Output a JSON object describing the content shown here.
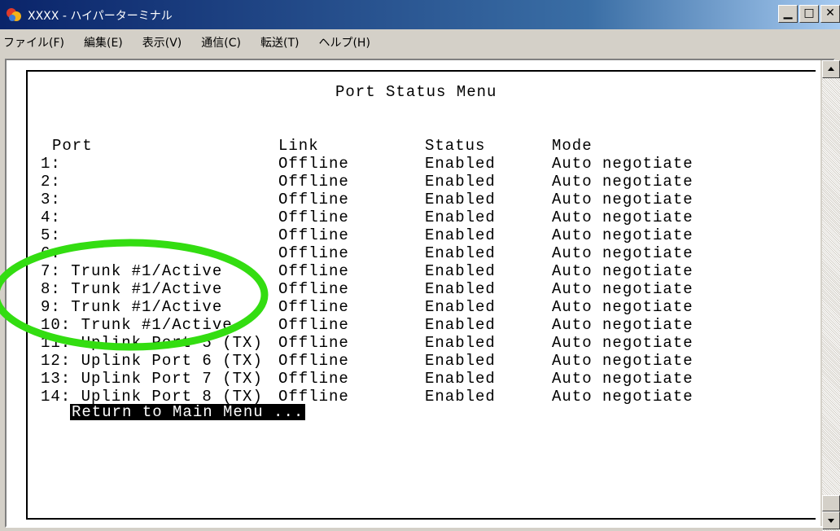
{
  "window": {
    "title": "XXXX - ハイパーターミナル"
  },
  "menu": [
    "ファイル(F)",
    "編集(E)",
    "表示(V)",
    "通信(C)",
    "転送(T)",
    "ヘルプ(H)"
  ],
  "terminal": {
    "heading": "Port Status Menu",
    "columns": {
      "port": "Port",
      "link": "Link",
      "status": "Status",
      "mode": "Mode"
    },
    "rows": [
      {
        "port": "1:",
        "link": "Offline",
        "status": "Enabled",
        "mode": "Auto negotiate"
      },
      {
        "port": "2:",
        "link": "Offline",
        "status": "Enabled",
        "mode": "Auto negotiate"
      },
      {
        "port": "3:",
        "link": "Offline",
        "status": "Enabled",
        "mode": "Auto negotiate"
      },
      {
        "port": "4:",
        "link": "Offline",
        "status": "Enabled",
        "mode": "Auto negotiate"
      },
      {
        "port": "5:",
        "link": "Offline",
        "status": "Enabled",
        "mode": "Auto negotiate"
      },
      {
        "port": "6:",
        "link": "Offline",
        "status": "Enabled",
        "mode": "Auto negotiate"
      },
      {
        "port": "7: Trunk #1/Active",
        "link": "Offline",
        "status": "Enabled",
        "mode": "Auto negotiate"
      },
      {
        "port": "8: Trunk #1/Active",
        "link": "Offline",
        "status": "Enabled",
        "mode": "Auto negotiate"
      },
      {
        "port": "9: Trunk #1/Active",
        "link": "Offline",
        "status": "Enabled",
        "mode": "Auto negotiate"
      },
      {
        "port": "10: Trunk #1/Active",
        "link": "Offline",
        "status": "Enabled",
        "mode": "Auto negotiate"
      },
      {
        "port": "11: Uplink Port 5 (TX)",
        "link": "Offline",
        "status": "Enabled",
        "mode": "Auto negotiate"
      },
      {
        "port": "12: Uplink Port 6 (TX)",
        "link": "Offline",
        "status": "Enabled",
        "mode": "Auto negotiate"
      },
      {
        "port": "13: Uplink Port 7 (TX)",
        "link": "Offline",
        "status": "Enabled",
        "mode": "Auto negotiate"
      },
      {
        "port": "14: Uplink Port 8 (TX)",
        "link": "Offline",
        "status": "Enabled",
        "mode": "Auto negotiate"
      }
    ],
    "return_label": "Return to Main Menu ..."
  },
  "colors": {
    "highlight": "#33dd11",
    "titlebar": "#0a246a"
  },
  "icons": {
    "app": "hyperterminal-icon"
  }
}
